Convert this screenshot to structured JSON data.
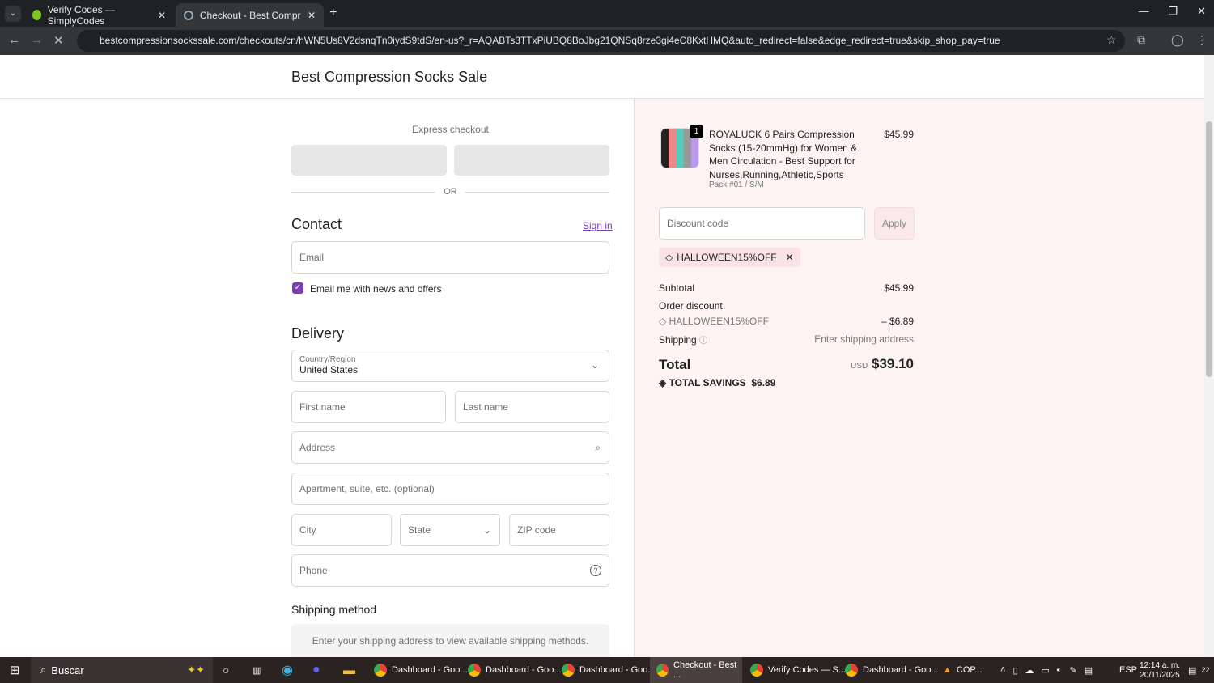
{
  "browser": {
    "tabs": [
      {
        "label": "Verify Codes — SimplyCodes"
      },
      {
        "label": "Checkout - Best Compression S"
      }
    ],
    "url": "bestcompressionsockssale.com/checkouts/cn/hWN5Us8V2dsnqTn0iydS9tdS/en-us?_r=AQABTs3TTxPiUBQ8BoJbg21QNSq8rze3gi4eC8KxtHMQ&auto_redirect=false&edge_redirect=true&skip_shop_pay=true"
  },
  "store": {
    "name": "Best Compression Socks Sale"
  },
  "checkout": {
    "express": "Express checkout",
    "or": "OR",
    "contact": "Contact",
    "sign_in": "Sign in",
    "email_ph": "Email",
    "news": "Email me with news and offers",
    "delivery": "Delivery",
    "country_label": "Country/Region",
    "country": "United States",
    "first": "First name",
    "last": "Last name",
    "address": "Address",
    "apt": "Apartment, suite, etc. (optional)",
    "city": "City",
    "state": "State",
    "zip": "ZIP code",
    "phone": "Phone",
    "shipping_method": "Shipping method",
    "shipping_msg": "Enter your shipping address to view available shipping methods."
  },
  "summary": {
    "qty": "1",
    "product": "ROYALUCK 6 Pairs Compression Socks (15-20mmHg) for Women & Men Circulation - Best Support for Nurses,Running,Athletic,Sports",
    "variant": "Pack #01 / S/M",
    "price": "$45.99",
    "discount_ph": "Discount code",
    "apply": "Apply",
    "code": "HALLOWEEN15%OFF",
    "subtotal_label": "Subtotal",
    "subtotal": "$45.99",
    "order_discount": "Order discount",
    "discount_amt": "– $6.89",
    "shipping_label": "Shipping",
    "shipping_val": "Enter shipping address",
    "total_label": "Total",
    "currency": "USD",
    "total": "$39.10",
    "savings_label": "TOTAL SAVINGS",
    "savings": "$6.89"
  },
  "taskbar": {
    "search": "Buscar",
    "items": [
      "Dashboard - Goo...",
      "Dashboard - Goo...",
      "Dashboard - Goo...",
      "Checkout - Best ...",
      "Verify Codes — S...",
      "Dashboard - Goo...",
      "COP..."
    ],
    "lang": "ESP",
    "time": "12:14 a. m.",
    "date": "20/11/2025",
    "notif": "22"
  }
}
